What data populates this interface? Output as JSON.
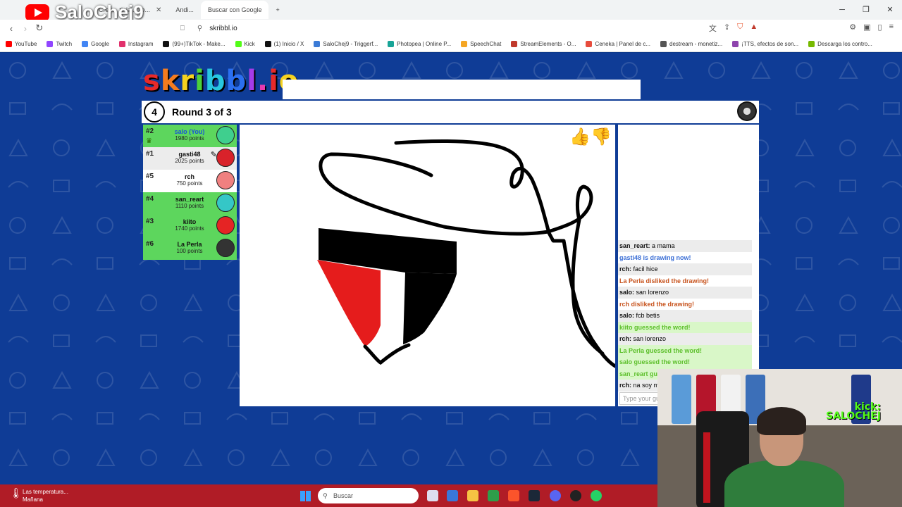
{
  "overlay": {
    "streamer_name": "SaloChej9",
    "kick_label": "kick:",
    "kick_name": "SALOCHEJ"
  },
  "browser": {
    "tabs": [
      {
        "label": "Crea... tinla... ko...",
        "active": false
      },
      {
        "label": "Andi...",
        "active": false
      },
      {
        "label": "Buscar con Google",
        "active": true
      }
    ],
    "url": "skribbl.io",
    "bookmarks": [
      {
        "label": "YouTube",
        "color": "#ff0000"
      },
      {
        "label": "Twitch",
        "color": "#9146ff"
      },
      {
        "label": "Google",
        "color": "#4285f4"
      },
      {
        "label": "Instagram",
        "color": "#e1306c"
      },
      {
        "label": "(99+)TikTok - Make...",
        "color": "#111111"
      },
      {
        "label": "Kick",
        "color": "#53fc18"
      },
      {
        "label": "(1) Inicio / X",
        "color": "#111111"
      },
      {
        "label": "SaloChej9 - Triggerf...",
        "color": "#3b7bd6"
      },
      {
        "label": "Photopea | Online P...",
        "color": "#18a497"
      },
      {
        "label": "SpeechChat",
        "color": "#f5a623"
      },
      {
        "label": "StreamElements - O...",
        "color": "#c0392b"
      },
      {
        "label": "Ceneka | Panel de c...",
        "color": "#e74c3c"
      },
      {
        "label": "destream - monetiz...",
        "color": "#555555"
      },
      {
        "label": "¡TTS, efectos de son...",
        "color": "#8e44ad"
      },
      {
        "label": "Descarga los contro...",
        "color": "#76b900"
      }
    ]
  },
  "game": {
    "logo_text": "skribbl.io",
    "timer": "4",
    "round": "Round 3 of 3",
    "players": [
      {
        "rank": "#2",
        "name": "salo (You)",
        "points": "1980 points",
        "bg": "#5dd65d",
        "avatar": "#3fcf8e",
        "you": true,
        "crown": true
      },
      {
        "rank": "#1",
        "name": "gasti48",
        "points": "2025 points",
        "bg": "#ececec",
        "avatar": "#d9222a",
        "drawing": true
      },
      {
        "rank": "#5",
        "name": "rch",
        "points": "750 points",
        "bg": "#ffffff",
        "avatar": "#f08080"
      },
      {
        "rank": "#4",
        "name": "san_reart",
        "points": "1110 points",
        "bg": "#5dd65d",
        "avatar": "#35c7c7"
      },
      {
        "rank": "#3",
        "name": "kiito",
        "points": "1740 points",
        "bg": "#5dd65d",
        "avatar": "#e52424"
      },
      {
        "rank": "#6",
        "name": "La Perla",
        "points": "100 points",
        "bg": "#5dd65d",
        "avatar": "#333333"
      }
    ],
    "chat": [
      {
        "type": "msg",
        "user": "san_reart:",
        "text": "a mama"
      },
      {
        "type": "sys-blue",
        "text": "gasti48 is drawing now!"
      },
      {
        "type": "msg",
        "user": "rch:",
        "text": "facil hice"
      },
      {
        "type": "sys-red",
        "text": "La Perla disliked the drawing!"
      },
      {
        "type": "msg",
        "user": "salo:",
        "text": "san lorenzo"
      },
      {
        "type": "sys-red",
        "text": "rch disliked the drawing!"
      },
      {
        "type": "msg",
        "user": "salo:",
        "text": "fcb betis"
      },
      {
        "type": "sys-green",
        "text": "kiito guessed the word!"
      },
      {
        "type": "msg",
        "user": "rch:",
        "text": "san lorenzo"
      },
      {
        "type": "sys-green",
        "text": "La Perla guessed the word!"
      },
      {
        "type": "sys-green",
        "text": "salo guessed the word!"
      },
      {
        "type": "sys-green",
        "text": "san_reart gu"
      },
      {
        "type": "msg",
        "user": "rch:",
        "text": "na soy m"
      }
    ],
    "chat_placeholder": "Type your gu"
  },
  "taskbar": {
    "weather_line1": "Las temperatura...",
    "weather_line2": "Mañana",
    "search_label": "Buscar"
  }
}
